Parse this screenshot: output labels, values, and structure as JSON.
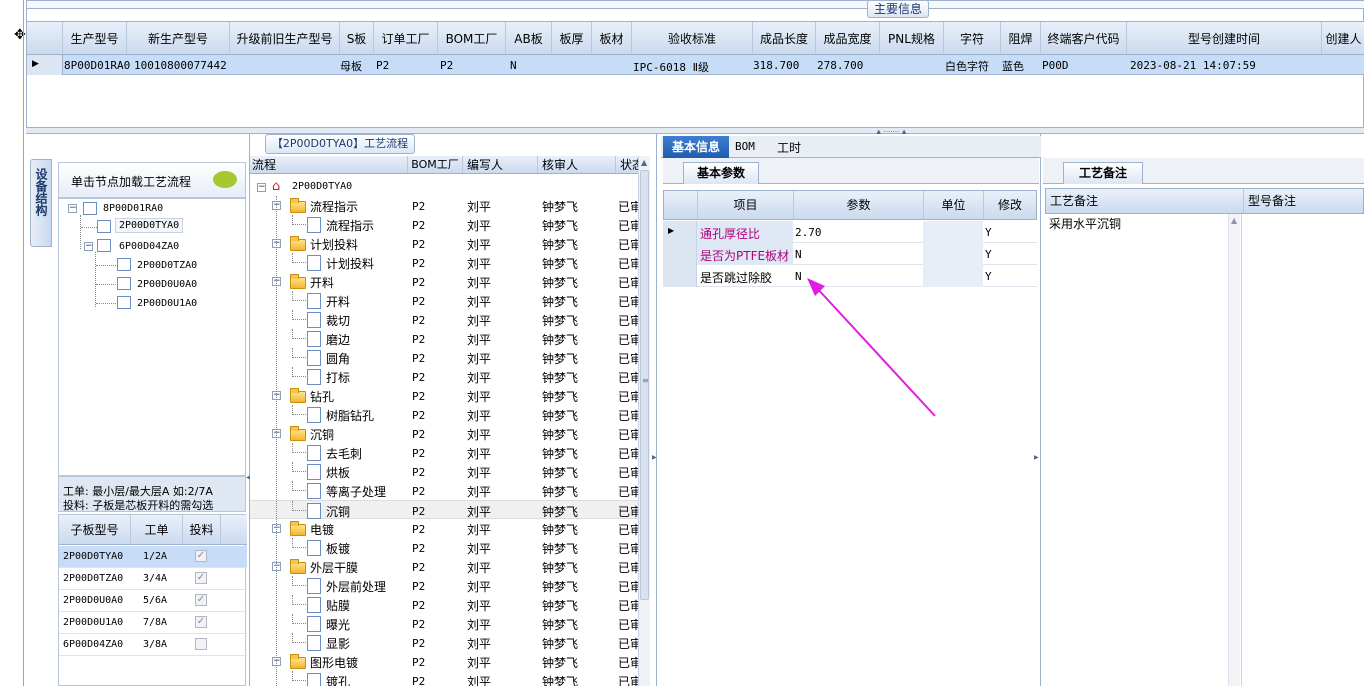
{
  "top": {
    "title": "主要信息",
    "columns": [
      "生产型号",
      "新生产型号",
      "升级前旧生产型号",
      "S板",
      "订单工厂",
      "BOM工厂",
      "AB板",
      "板厚",
      "板材",
      "验收标准",
      "成品长度",
      "成品宽度",
      "PNL规格",
      "字符",
      "阻焊",
      "终端客户代码",
      "型号创建时间",
      "创建人"
    ],
    "row": {
      "prod_model": "8P00D01RA0",
      "new_model": "10010800077442",
      "old_model": "",
      "s_board": "母板",
      "order_factory": "P2",
      "bom_factory": "P2",
      "ab_board": "N",
      "thickness": "",
      "material": "",
      "standard": "IPC-6018 Ⅱ级",
      "length": "318.700",
      "width": "278.700",
      "pnl": "",
      "char": "白色字符",
      "mask": "蓝色",
      "customer": "P00D",
      "created": "2023-08-21 14:07:59",
      "creator": ""
    }
  },
  "left_panel": {
    "side_tab": "设备结构",
    "load_button": "单击节点加载工艺流程",
    "tree": [
      {
        "label": "8P00D01RA0",
        "level": 0
      },
      {
        "label": "2P00D0TYA0",
        "level": 1
      },
      {
        "label": "6P00D04ZA0",
        "level": 1
      },
      {
        "label": "2P00D0TZA0",
        "level": 2
      },
      {
        "label": "2P00D0U0A0",
        "level": 2
      },
      {
        "label": "2P00D0U1A0",
        "level": 2
      }
    ],
    "note_line1": "工单: 最小层/最大层A 如:2/7A",
    "note_line2": "投料: 子板是芯板开料的需勾选",
    "sub_table": {
      "headers": [
        "子板型号",
        "工单",
        "投料"
      ],
      "rows": [
        {
          "model": "2P00D0TYA0",
          "order": "1/2A",
          "feed": "✓"
        },
        {
          "model": "2P00D0TZA0",
          "order": "3/4A",
          "feed": "✓"
        },
        {
          "model": "2P00D0U0A0",
          "order": "5/6A",
          "feed": "✓"
        },
        {
          "model": "2P00D0U1A0",
          "order": "7/8A",
          "feed": "✓"
        },
        {
          "model": "6P00D04ZA0",
          "order": "3/8A",
          "feed": ""
        }
      ]
    }
  },
  "flow_panel": {
    "title": "【2P00D0TYA0】工艺流程",
    "headers": [
      "流程",
      "BOM工厂",
      "编写人",
      "核审人",
      "状态"
    ],
    "root": "2P00D0TYA0",
    "rows": [
      {
        "label": "流程指示",
        "type": "folder",
        "bom": "P2",
        "writer": "刘平",
        "reviewer": "钟梦飞",
        "status": "已审"
      },
      {
        "label": "流程指示",
        "type": "doc",
        "bom": "P2",
        "writer": "刘平",
        "reviewer": "钟梦飞",
        "status": "已审"
      },
      {
        "label": "计划投料",
        "type": "folder",
        "bom": "P2",
        "writer": "刘平",
        "reviewer": "钟梦飞",
        "status": "已审"
      },
      {
        "label": "计划投料",
        "type": "doc",
        "bom": "P2",
        "writer": "刘平",
        "reviewer": "钟梦飞",
        "status": "已审"
      },
      {
        "label": "开料",
        "type": "folder",
        "bom": "P2",
        "writer": "刘平",
        "reviewer": "钟梦飞",
        "status": "已审"
      },
      {
        "label": "开料",
        "type": "doc",
        "bom": "P2",
        "writer": "刘平",
        "reviewer": "钟梦飞",
        "status": "已审"
      },
      {
        "label": "裁切",
        "type": "doc",
        "bom": "P2",
        "writer": "刘平",
        "reviewer": "钟梦飞",
        "status": "已审"
      },
      {
        "label": "磨边",
        "type": "doc",
        "bom": "P2",
        "writer": "刘平",
        "reviewer": "钟梦飞",
        "status": "已审"
      },
      {
        "label": "圆角",
        "type": "doc",
        "bom": "P2",
        "writer": "刘平",
        "reviewer": "钟梦飞",
        "status": "已审"
      },
      {
        "label": "打标",
        "type": "doc",
        "bom": "P2",
        "writer": "刘平",
        "reviewer": "钟梦飞",
        "status": "已审"
      },
      {
        "label": "钻孔",
        "type": "folder",
        "bom": "P2",
        "writer": "刘平",
        "reviewer": "钟梦飞",
        "status": "已审"
      },
      {
        "label": "树脂钻孔",
        "type": "doc",
        "bom": "P2",
        "writer": "刘平",
        "reviewer": "钟梦飞",
        "status": "已审"
      },
      {
        "label": "沉铜",
        "type": "folder",
        "bom": "P2",
        "writer": "刘平",
        "reviewer": "钟梦飞",
        "status": "已审"
      },
      {
        "label": "去毛刺",
        "type": "doc",
        "bom": "P2",
        "writer": "刘平",
        "reviewer": "钟梦飞",
        "status": "已审"
      },
      {
        "label": "烘板",
        "type": "doc",
        "bom": "P2",
        "writer": "刘平",
        "reviewer": "钟梦飞",
        "status": "已审"
      },
      {
        "label": "等离子处理",
        "type": "doc",
        "bom": "P2",
        "writer": "刘平",
        "reviewer": "钟梦飞",
        "status": "已审"
      },
      {
        "label": "沉铜",
        "type": "doc",
        "bom": "P2",
        "writer": "刘平",
        "reviewer": "钟梦飞",
        "status": "已审",
        "selected": true
      },
      {
        "label": "电镀",
        "type": "folder",
        "bom": "P2",
        "writer": "刘平",
        "reviewer": "钟梦飞",
        "status": "已审"
      },
      {
        "label": "板镀",
        "type": "doc",
        "bom": "P2",
        "writer": "刘平",
        "reviewer": "钟梦飞",
        "status": "已审"
      },
      {
        "label": "外层干膜",
        "type": "folder",
        "bom": "P2",
        "writer": "刘平",
        "reviewer": "钟梦飞",
        "status": "已审"
      },
      {
        "label": "外层前处理",
        "type": "doc",
        "bom": "P2",
        "writer": "刘平",
        "reviewer": "钟梦飞",
        "status": "已审"
      },
      {
        "label": "贴膜",
        "type": "doc",
        "bom": "P2",
        "writer": "刘平",
        "reviewer": "钟梦飞",
        "status": "已审"
      },
      {
        "label": "曝光",
        "type": "doc",
        "bom": "P2",
        "writer": "刘平",
        "reviewer": "钟梦飞",
        "status": "已审"
      },
      {
        "label": "显影",
        "type": "doc",
        "bom": "P2",
        "writer": "刘平",
        "reviewer": "钟梦飞",
        "status": "已审"
      },
      {
        "label": "图形电镀",
        "type": "folder",
        "bom": "P2",
        "writer": "刘平",
        "reviewer": "钟梦飞",
        "status": "已审"
      },
      {
        "label": "镀孔",
        "type": "doc",
        "bom": "P2",
        "writer": "刘平",
        "reviewer": "钟梦飞",
        "status": "已审"
      }
    ]
  },
  "info_panel": {
    "tabs": [
      "基本信息",
      "BOM",
      "工时"
    ],
    "sub_tab": "基本参数",
    "headers": [
      "项目",
      "参数",
      "单位",
      "修改"
    ],
    "rows": [
      {
        "item": "通孔厚径比",
        "value": "2.70",
        "unit": "",
        "modify": "Y"
      },
      {
        "item": "是否为PTFE板材",
        "value": "N",
        "unit": "",
        "modify": "Y"
      },
      {
        "item": "是否跳过除胶",
        "value": "N",
        "unit": "",
        "modify": "Y"
      }
    ],
    "annotation_color": "#e01ee0"
  },
  "remarks_panel": {
    "tab": "工艺备注",
    "headers": [
      "工艺备注",
      "型号备注"
    ],
    "process_note": "采用水平沉铜",
    "model_note": ""
  }
}
